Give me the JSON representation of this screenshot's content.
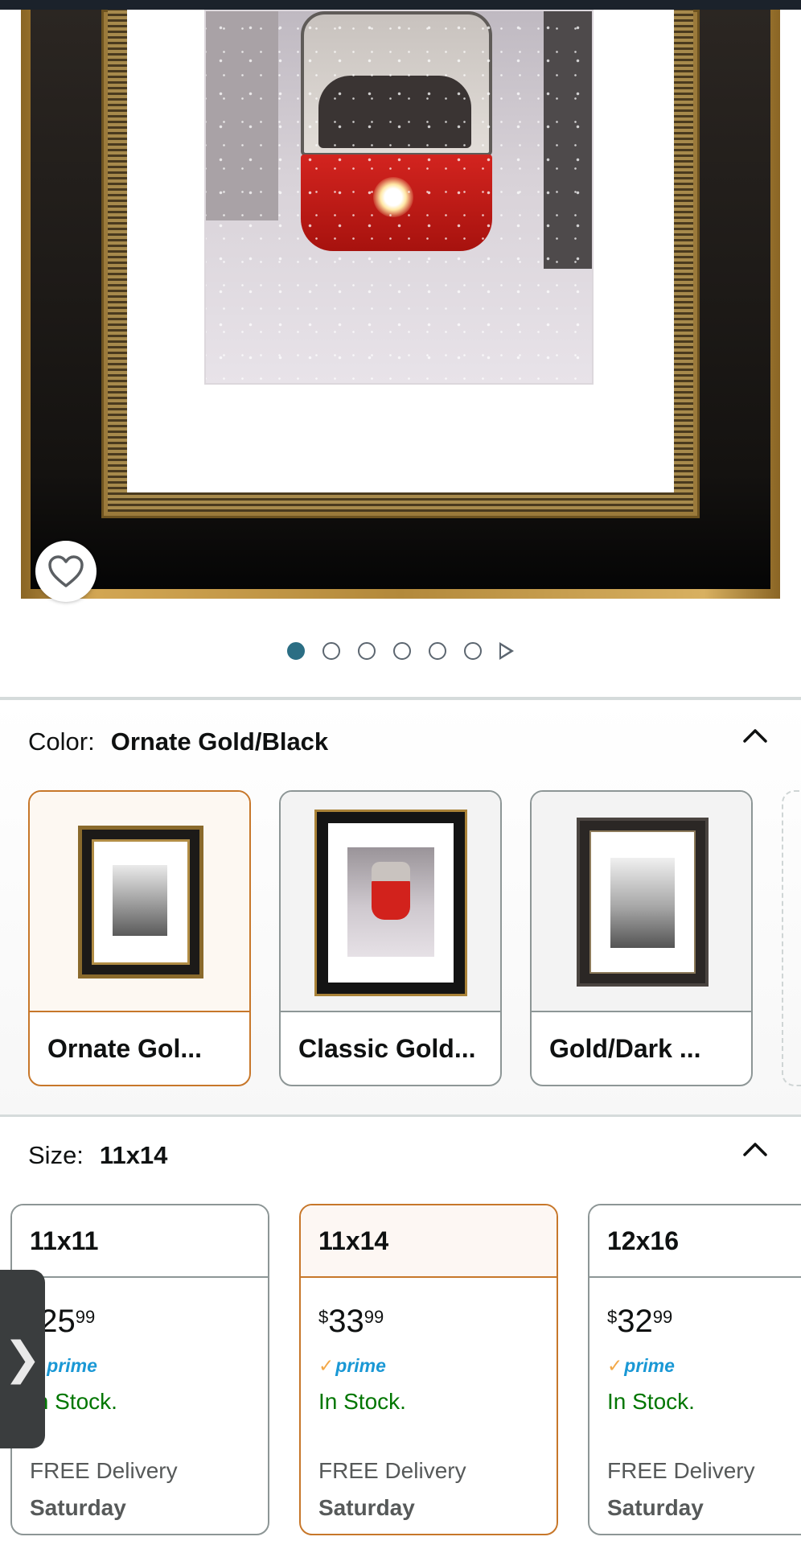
{
  "product_image": {
    "favorite_icon": "heart-outline-icon"
  },
  "carousel": {
    "count": 6,
    "active_index": 0,
    "play_icon": "play-icon"
  },
  "color": {
    "label": "Color:",
    "selected": "Ornate Gold/Black",
    "collapse_icon": "chevron-up-icon",
    "options": [
      {
        "label": "Ornate Gol..."
      },
      {
        "label": "Classic Gold..."
      },
      {
        "label": "Gold/Dark ..."
      }
    ]
  },
  "size": {
    "label": "Size:",
    "selected": "11x14",
    "collapse_icon": "chevron-up-icon",
    "options": [
      {
        "size": "11x11",
        "symbol": "$",
        "whole": "25",
        "frac": "99",
        "prime_check": "✓",
        "prime": "prime",
        "stock": "In Stock.",
        "delivery": "FREE Delivery",
        "day": "Saturday"
      },
      {
        "size": "11x14",
        "symbol": "$",
        "whole": "33",
        "frac": "99",
        "prime_check": "✓",
        "prime": "prime",
        "stock": "In Stock.",
        "delivery": "FREE Delivery",
        "day": "Saturday"
      },
      {
        "size": "12x16",
        "symbol": "$",
        "whole": "32",
        "frac": "99",
        "prime_check": "✓",
        "prime": "prime",
        "stock": "In Stock.",
        "delivery": "FREE Delivery",
        "day": "Saturday"
      }
    ]
  },
  "side_handle": {
    "glyph": "❯",
    "icon": "chevron-right-icon"
  },
  "colors": {
    "accent": "#c7772a",
    "prime_blue": "#1a98d5",
    "in_stock": "#007600",
    "dot_active": "#2b6e84"
  }
}
